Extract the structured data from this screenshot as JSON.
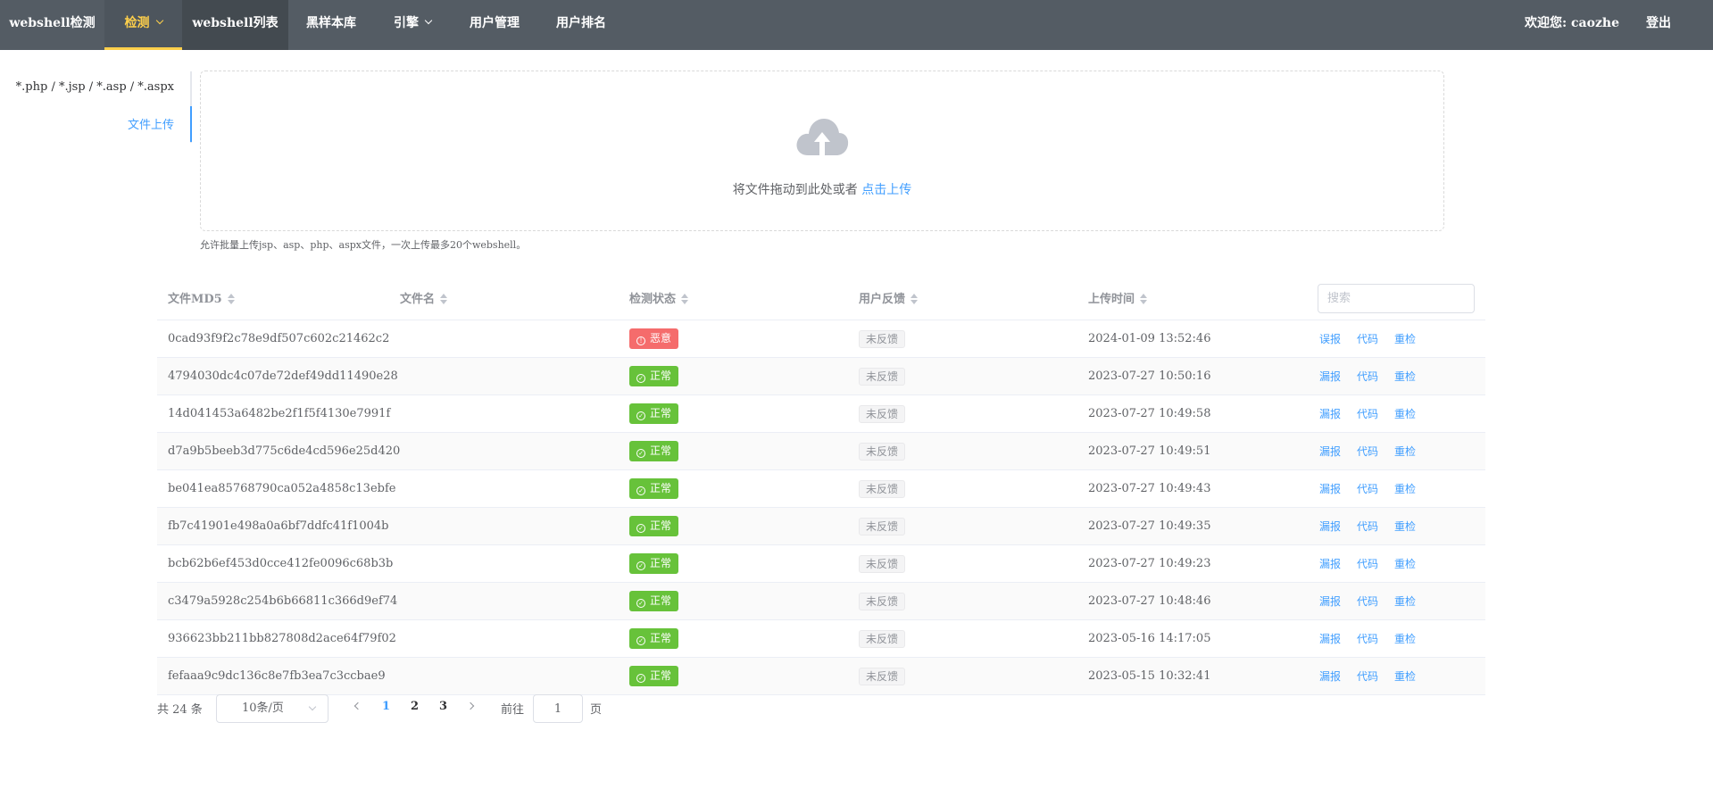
{
  "nav": {
    "items": [
      {
        "label": "webshell检测"
      },
      {
        "label": "检测"
      },
      {
        "label": "webshell列表"
      },
      {
        "label": "黑样本库"
      },
      {
        "label": "引擎"
      },
      {
        "label": "用户管理"
      },
      {
        "label": "用户排名"
      }
    ],
    "welcome": "欢迎您: caozhe",
    "logout": "登出",
    "active_color": "#ffd04b",
    "background": "#545c64"
  },
  "side": {
    "tabs": [
      {
        "label": "*.php / *.jsp / *.asp / *.aspx"
      },
      {
        "label": "文件上传"
      }
    ]
  },
  "upload": {
    "icon": "cloud-upload-icon",
    "text": "将文件拖动到此处或者",
    "link": "点击上传",
    "tip": "允许批量上传jsp、asp、php、aspx文件，一次上传最多20个webshell。"
  },
  "table": {
    "headers": [
      "文件MD5",
      "文件名",
      "检测状态",
      "用户反馈",
      "上传时间"
    ],
    "search_placeholder": "搜索",
    "rows": [
      {
        "md5": "0cad93f9f2c78e9df507c602c21462c2",
        "name": "",
        "status": "恶意",
        "status_type": "bad",
        "feedback": "未反馈",
        "time": "2024-01-09 13:52:46",
        "actions": [
          "误报",
          "代码",
          "重检"
        ]
      },
      {
        "md5": "4794030dc4c07de72def49dd11490e28",
        "name": "",
        "status": "正常",
        "status_type": "ok",
        "feedback": "未反馈",
        "time": "2023-07-27 10:50:16",
        "actions": [
          "漏报",
          "代码",
          "重检"
        ]
      },
      {
        "md5": "14d041453a6482be2f1f5f4130e7991f",
        "name": "",
        "status": "正常",
        "status_type": "ok",
        "feedback": "未反馈",
        "time": "2023-07-27 10:49:58",
        "actions": [
          "漏报",
          "代码",
          "重检"
        ]
      },
      {
        "md5": "d7a9b5beeb3d775c6de4cd596e25d420",
        "name": "",
        "status": "正常",
        "status_type": "ok",
        "feedback": "未反馈",
        "time": "2023-07-27 10:49:51",
        "actions": [
          "漏报",
          "代码",
          "重检"
        ]
      },
      {
        "md5": "be041ea85768790ca052a4858c13ebfe",
        "name": "",
        "status": "正常",
        "status_type": "ok",
        "feedback": "未反馈",
        "time": "2023-07-27 10:49:43",
        "actions": [
          "漏报",
          "代码",
          "重检"
        ]
      },
      {
        "md5": "fb7c41901e498a0a6bf7ddfc41f1004b",
        "name": "",
        "status": "正常",
        "status_type": "ok",
        "feedback": "未反馈",
        "time": "2023-07-27 10:49:35",
        "actions": [
          "漏报",
          "代码",
          "重检"
        ]
      },
      {
        "md5": "bcb62b6ef453d0cce412fe0096c68b3b",
        "name": "",
        "status": "正常",
        "status_type": "ok",
        "feedback": "未反馈",
        "time": "2023-07-27 10:49:23",
        "actions": [
          "漏报",
          "代码",
          "重检"
        ]
      },
      {
        "md5": "c3479a5928c254b6b66811c366d9ef74",
        "name": "",
        "status": "正常",
        "status_type": "ok",
        "feedback": "未反馈",
        "time": "2023-07-27 10:48:46",
        "actions": [
          "漏报",
          "代码",
          "重检"
        ]
      },
      {
        "md5": "936623bb211bb827808d2ace64f79f02",
        "name": "",
        "status": "正常",
        "status_type": "ok",
        "feedback": "未反馈",
        "time": "2023-05-16 14:17:05",
        "actions": [
          "漏报",
          "代码",
          "重检"
        ]
      },
      {
        "md5": "fefaaa9c9dc136c8e7fb3ea7c3ccbae9",
        "name": "",
        "status": "正常",
        "status_type": "ok",
        "feedback": "未反馈",
        "time": "2023-05-15 10:32:41",
        "actions": [
          "漏报",
          "代码",
          "重检"
        ]
      }
    ]
  },
  "pagination": {
    "total": "共 24 条",
    "page_size": "10条/页",
    "pages": [
      "1",
      "2",
      "3"
    ],
    "current": "1",
    "goto_label": "前往",
    "goto_value": "1",
    "goto_unit": "页"
  }
}
